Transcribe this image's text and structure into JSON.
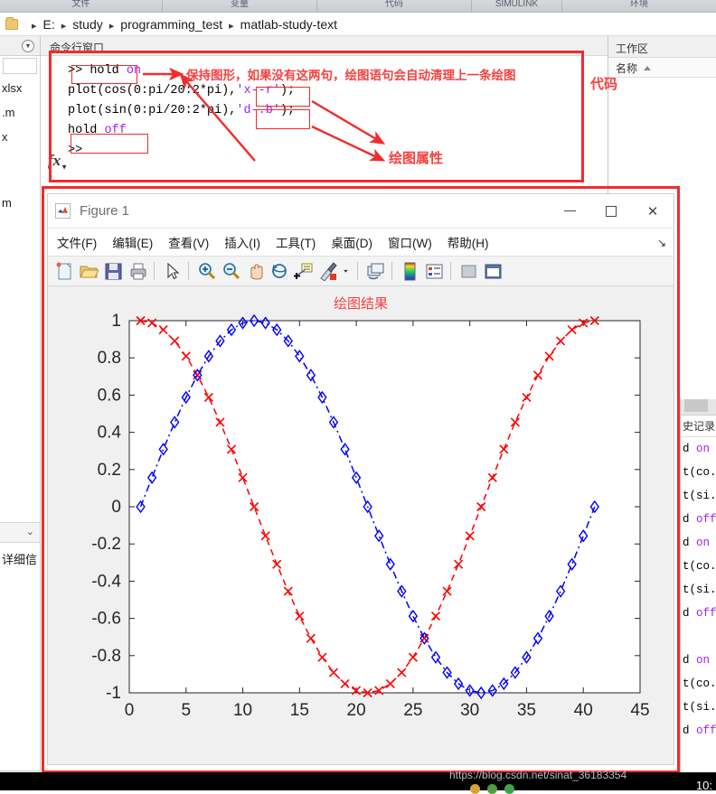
{
  "ribbon": {
    "groups": [
      "文件",
      "变量",
      "代码",
      "SIMULINK",
      "环境"
    ]
  },
  "breadcrumb": {
    "folder_icon": "folder-icon",
    "separator": "▸",
    "items": [
      "E:",
      "study",
      "programming_test",
      "matlab-study-text"
    ]
  },
  "left_panel": {
    "chevron_icon": "chevron-down-icon",
    "files": [
      "xlsx",
      ".m",
      "x",
      "m"
    ],
    "collapse_icon": "chevron-down-icon",
    "details_label": "详细信",
    "expand_icon": "›"
  },
  "command_window": {
    "chevron_icon": "chevron-down-icon",
    "title": "命令行窗口",
    "fx_icon": "fx-icon",
    "lines": [
      {
        "prompt": ">>",
        "tokens": [
          {
            "t": "hold ",
            "c": "plain"
          },
          {
            "t": "on",
            "c": "purple"
          }
        ]
      },
      {
        "prompt": "",
        "tokens": [
          {
            "t": "plot(cos(0:pi/20:2*pi),",
            "c": "plain"
          },
          {
            "t": "'x--r'",
            "c": "purple"
          },
          {
            "t": ");",
            "c": "plain"
          }
        ]
      },
      {
        "prompt": "",
        "tokens": [
          {
            "t": "plot(sin(0:pi/20:2*pi),",
            "c": "plain"
          },
          {
            "t": "'d-.b'",
            "c": "purple"
          },
          {
            "t": ");",
            "c": "plain"
          }
        ]
      },
      {
        "prompt": "",
        "tokens": [
          {
            "t": "hold ",
            "c": "plain"
          },
          {
            "t": "off",
            "c": "purple"
          }
        ]
      },
      {
        "prompt": ">>",
        "tokens": []
      }
    ]
  },
  "annotations": {
    "hold_note": "保持图形，如果没有这两句，绘图语句会自动清理上一条绘图",
    "code_label": "代码",
    "plot_props_label": "绘图属性",
    "accent_color": "#f22b2b"
  },
  "workspace": {
    "title": "工作区",
    "column_name": "名称",
    "sort_icon": "sort-ascending-icon"
  },
  "command_history": {
    "title": "史记录",
    "lines": [
      "d on",
      "t(co.",
      "t(si.",
      "d off",
      "d on",
      "t(co.",
      "t(si.",
      "d off",
      "",
      "d on",
      "t(co.",
      "t(si.",
      "d off"
    ],
    "keyword_lines": [
      0,
      3,
      4,
      7,
      9,
      12
    ]
  },
  "figure_window": {
    "app_icon": "matlab-logo-icon",
    "title": "Figure 1",
    "minimize_icon": "minimize-icon",
    "maximize_icon": "maximize-icon",
    "close_icon": "close-icon",
    "menu": [
      "文件(F)",
      "编辑(E)",
      "查看(V)",
      "插入(I)",
      "工具(T)",
      "桌面(D)",
      "窗口(W)",
      "帮助(H)"
    ],
    "menu_overflow_icon": "overflow-arrow-icon",
    "toolbar": [
      {
        "name": "new-figure-icon"
      },
      {
        "name": "open-file-icon"
      },
      {
        "name": "save-figure-icon"
      },
      {
        "name": "print-figure-icon"
      },
      {
        "name": "separator"
      },
      {
        "name": "pointer-select-icon"
      },
      {
        "name": "separator"
      },
      {
        "name": "zoom-in-icon"
      },
      {
        "name": "zoom-out-icon"
      },
      {
        "name": "pan-icon"
      },
      {
        "name": "rotate-3d-icon"
      },
      {
        "name": "data-cursor-icon"
      },
      {
        "name": "brush-data-icon"
      },
      {
        "name": "brush-dropdown-icon"
      },
      {
        "name": "separator"
      },
      {
        "name": "link-plot-icon"
      },
      {
        "name": "separator"
      },
      {
        "name": "colorbar-icon"
      },
      {
        "name": "legend-icon"
      },
      {
        "name": "separator"
      },
      {
        "name": "hide-plot-tools-icon"
      },
      {
        "name": "show-plot-tools-icon"
      }
    ]
  },
  "chart_data": {
    "type": "line",
    "title": "绘图结果",
    "xlabel": "",
    "ylabel": "",
    "xlim": [
      0,
      45
    ],
    "ylim": [
      -1,
      1
    ],
    "xticks": [
      0,
      5,
      10,
      15,
      20,
      25,
      30,
      35,
      40,
      45
    ],
    "yticks": [
      -1,
      -0.8,
      -0.6,
      -0.4,
      -0.2,
      0,
      0.2,
      0.4,
      0.6,
      0.8,
      1
    ],
    "grid": false,
    "legend_position": "none",
    "n_points": 41,
    "sample_step_rad": 0.15707963267948966,
    "series": [
      {
        "name": "cos(0:pi/20:2*pi)",
        "color": "#ff0000",
        "marker": "x",
        "linestyle": "--",
        "x": [
          1,
          2,
          3,
          4,
          5,
          6,
          7,
          8,
          9,
          10,
          11,
          12,
          13,
          14,
          15,
          16,
          17,
          18,
          19,
          20,
          21,
          22,
          23,
          24,
          25,
          26,
          27,
          28,
          29,
          30,
          31,
          32,
          33,
          34,
          35,
          36,
          37,
          38,
          39,
          40,
          41
        ],
        "values": [
          1.0,
          0.9877,
          0.9511,
          0.891,
          0.809,
          0.7071,
          0.5878,
          0.454,
          0.309,
          0.1564,
          0.0,
          -0.1564,
          -0.309,
          -0.454,
          -0.5878,
          -0.7071,
          -0.809,
          -0.891,
          -0.9511,
          -0.9877,
          -1.0,
          -0.9877,
          -0.9511,
          -0.891,
          -0.809,
          -0.7071,
          -0.5878,
          -0.454,
          -0.309,
          -0.1564,
          0.0,
          0.1564,
          0.309,
          0.454,
          0.5878,
          0.7071,
          0.809,
          0.891,
          0.9511,
          0.9877,
          1.0
        ]
      },
      {
        "name": "sin(0:pi/20:2*pi)",
        "color": "#0000ff",
        "marker": "d",
        "linestyle": "-.",
        "x": [
          1,
          2,
          3,
          4,
          5,
          6,
          7,
          8,
          9,
          10,
          11,
          12,
          13,
          14,
          15,
          16,
          17,
          18,
          19,
          20,
          21,
          22,
          23,
          24,
          25,
          26,
          27,
          28,
          29,
          30,
          31,
          32,
          33,
          34,
          35,
          36,
          37,
          38,
          39,
          40,
          41
        ],
        "values": [
          0.0,
          0.1564,
          0.309,
          0.454,
          0.5878,
          0.7071,
          0.809,
          0.891,
          0.9511,
          0.9877,
          1.0,
          0.9877,
          0.9511,
          0.891,
          0.809,
          0.7071,
          0.5878,
          0.454,
          0.309,
          0.1564,
          0.0,
          -0.1564,
          -0.309,
          -0.454,
          -0.5878,
          -0.7071,
          -0.809,
          -0.891,
          -0.9511,
          -0.9877,
          -1.0,
          -0.9877,
          -0.9511,
          -0.891,
          -0.809,
          -0.7071,
          -0.5878,
          -0.454,
          -0.309,
          -0.1564,
          0.0
        ]
      }
    ]
  },
  "watermark": {
    "url": "https://blog.csdn.net/sinat_36183354",
    "clock": "10:"
  }
}
